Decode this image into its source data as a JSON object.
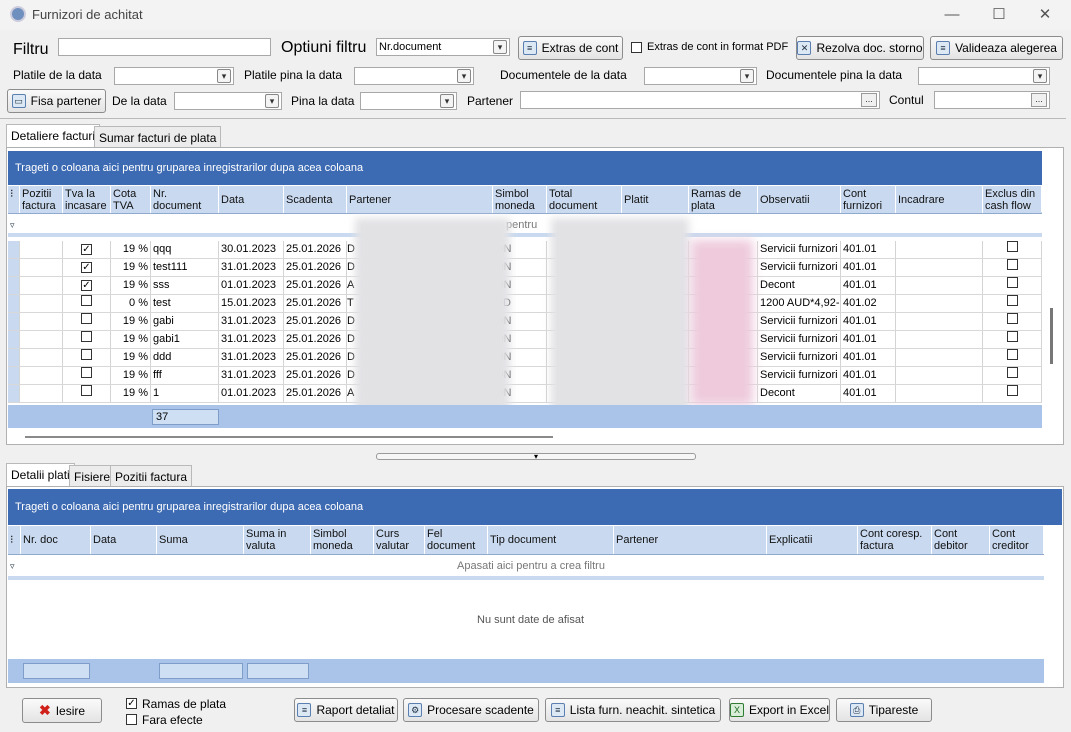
{
  "window": {
    "title": "Furnizori de achitat",
    "minimize": "—",
    "maximize": "☐",
    "close": "✕"
  },
  "filter": {
    "filtru_label": "Filtru",
    "filtru_value": "",
    "optiuni_label": "Optiuni filtru",
    "optiuni_value": "Nr.document",
    "extras_btn": "Extras de cont",
    "extras_pdf_label": "Extras de cont in format PDF",
    "extras_pdf_checked": false,
    "rezolva_btn": "Rezolva doc. storno",
    "valideaza_btn": "Valideaza alegerea",
    "platile_de_la": "Platile de la data",
    "platile_pina": "Platile pina la data",
    "doc_de_la": "Documentele de la data",
    "doc_pina": "Documentele pina la data",
    "fisa_btn": "Fisa partener",
    "de_la": "De la data",
    "pina_la": "Pina la data",
    "partener": "Partener",
    "contul": "Contul",
    "ellipsis": "..."
  },
  "tabs_top": [
    "Detaliere facturi",
    "Sumar facturi de plata"
  ],
  "grid1": {
    "group_text": "Trageti o coloana aici pentru gruparea inregistrarilor dupa acea coloana",
    "columns": [
      "Pozitii factura",
      "Tva la incasare",
      "Cota TVA",
      "Nr. document",
      "Data",
      "Scadenta",
      "Partener",
      "Simbol moneda",
      "Total document",
      "Platit",
      "Ramas de plata",
      "Observatii",
      "Cont furnizori",
      "Incadrare",
      "Exclus din cash flow si penalitati"
    ],
    "filter_hint": "pentru",
    "rows": [
      {
        "tva": true,
        "cota": "19 %",
        "nr": "qqq",
        "data": "30.01.2023",
        "scad": "25.01.2026",
        "p": "D",
        "mon": "ON",
        "obs": "Servicii furnizori",
        "cont": "401.01"
      },
      {
        "tva": true,
        "cota": "19 %",
        "nr": "test111",
        "data": "31.01.2023",
        "scad": "25.01.2026",
        "p": "D",
        "mon": "ON",
        "obs": "Servicii furnizori",
        "cont": "401.01"
      },
      {
        "tva": true,
        "cota": "19 %",
        "nr": "sss",
        "data": "01.01.2023",
        "scad": "25.01.2026",
        "p": "A",
        "mon": "ON",
        "obs": "Decont",
        "cont": "401.01"
      },
      {
        "tva": false,
        "cota": "0 %",
        "nr": "test",
        "data": "15.01.2023",
        "scad": "25.01.2026",
        "p": "T",
        "mon": "UD",
        "obs": "1200 AUD*4,92-",
        "cont": "401.02"
      },
      {
        "tva": false,
        "cota": "19 %",
        "nr": "gabi",
        "data": "31.01.2023",
        "scad": "25.01.2026",
        "p": "D",
        "mon": "ON",
        "obs": "Servicii furnizori",
        "cont": "401.01"
      },
      {
        "tva": false,
        "cota": "19 %",
        "nr": "gabi1",
        "data": "31.01.2023",
        "scad": "25.01.2026",
        "p": "D",
        "mon": "ON",
        "obs": "Servicii furnizori",
        "cont": "401.01"
      },
      {
        "tva": false,
        "cota": "19 %",
        "nr": "ddd",
        "data": "31.01.2023",
        "scad": "25.01.2026",
        "p": "D",
        "mon": "ON",
        "obs": "Servicii furnizori",
        "cont": "401.01"
      },
      {
        "tva": false,
        "cota": "19 %",
        "nr": "fff",
        "data": "31.01.2023",
        "scad": "25.01.2026",
        "p": "D",
        "mon": "ON",
        "obs": "Servicii furnizori",
        "cont": "401.01"
      },
      {
        "tva": false,
        "cota": "19 %",
        "nr": "1",
        "data": "01.01.2023",
        "scad": "25.01.2026",
        "p": "A",
        "mon": "ON",
        "obs": "Decont",
        "cont": "401.01"
      }
    ],
    "count": "37"
  },
  "tabs_bottom": [
    "Detalii plati",
    "Fisiere",
    "Pozitii factura"
  ],
  "grid2": {
    "group_text": "Trageti o coloana aici pentru gruparea inregistrarilor dupa acea coloana",
    "columns": [
      "Nr. doc",
      "Data",
      "Suma",
      "Suma in valuta",
      "Simbol moneda",
      "Curs valutar",
      "Fel document",
      "Tip document",
      "Partener",
      "Explicatii",
      "Cont coresp. factura",
      "Cont debitor",
      "Cont creditor"
    ],
    "filter_hint": "Apasati aici pentru a  crea filtru",
    "empty": "Nu sunt date de afisat"
  },
  "bottom": {
    "iesire": "Iesire",
    "ramas_label": "Ramas de plata",
    "ramas_checked": true,
    "fara_label": "Fara efecte",
    "fara_checked": false,
    "raport": "Raport detaliat",
    "procesare": "Procesare scadente",
    "lista": "Lista furn. neachit. sintetica",
    "export": "Export in Excel",
    "tipareste": "Tipareste"
  },
  "icons": [
    "app-icon",
    "dropdown-icon",
    "ellipsis-icon",
    "check-icon",
    "close-icon",
    "excel-icon",
    "print-icon",
    "filter-icon"
  ]
}
